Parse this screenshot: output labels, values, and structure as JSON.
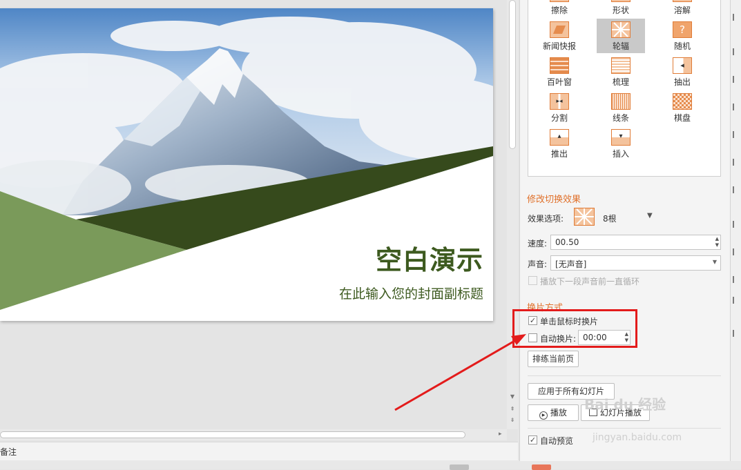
{
  "slide": {
    "title": "空白演示",
    "subtitle": "在此输入您的封面副标题",
    "colors": {
      "dark_green": "#364a1c",
      "light_green": "#7a9a5a",
      "title_color": "#3d5a1f"
    }
  },
  "notes_label": "备注",
  "transition_effects": [
    {
      "label": "擦除",
      "icon": "wipe-icon",
      "selected": false
    },
    {
      "label": "形状",
      "icon": "shape-icon",
      "selected": false
    },
    {
      "label": "溶解",
      "icon": "dissolve-icon",
      "selected": false
    },
    {
      "label": "新闻快报",
      "icon": "newsflash-icon",
      "selected": false
    },
    {
      "label": "轮辐",
      "icon": "wheel-icon",
      "selected": true
    },
    {
      "label": "随机",
      "icon": "random-icon",
      "selected": false
    },
    {
      "label": "百叶窗",
      "icon": "blinds-icon",
      "selected": false
    },
    {
      "label": "梳理",
      "icon": "comb-icon",
      "selected": false
    },
    {
      "label": "抽出",
      "icon": "pull-icon",
      "selected": false
    },
    {
      "label": "分割",
      "icon": "split-icon",
      "selected": false
    },
    {
      "label": "线条",
      "icon": "lines-icon",
      "selected": false
    },
    {
      "label": "棋盘",
      "icon": "checkerboard-icon",
      "selected": false
    },
    {
      "label": "推出",
      "icon": "push-icon",
      "selected": false
    },
    {
      "label": "插入",
      "icon": "cover-icon",
      "selected": false
    }
  ],
  "modify": {
    "section_title": "修改切换效果",
    "effect_option_label": "效果选项:",
    "effect_option_value": "8根",
    "speed_label": "速度:",
    "speed_value": "00.50",
    "sound_label": "声音:",
    "sound_value": "[无声音]",
    "loop_label": "播放下一段声音前一直循环",
    "loop_checked": false
  },
  "advance": {
    "section_title": "换片方式",
    "on_click_label": "单击鼠标时换片",
    "on_click_checked": true,
    "auto_label": "自动换片:",
    "auto_checked": false,
    "auto_time": "00:00"
  },
  "buttons": {
    "rehearse": "排练当前页",
    "apply_all": "应用于所有幻灯片",
    "play": "播放",
    "slideshow": "幻灯片播放"
  },
  "autopreview": {
    "label": "自动预览",
    "checked": true
  },
  "watermark": {
    "text": "Bai du 经验",
    "url_text": "jingyan.baidu.com"
  },
  "accent_colors": {
    "orange": "#e0702a",
    "annotation_red": "#e31b1b"
  }
}
